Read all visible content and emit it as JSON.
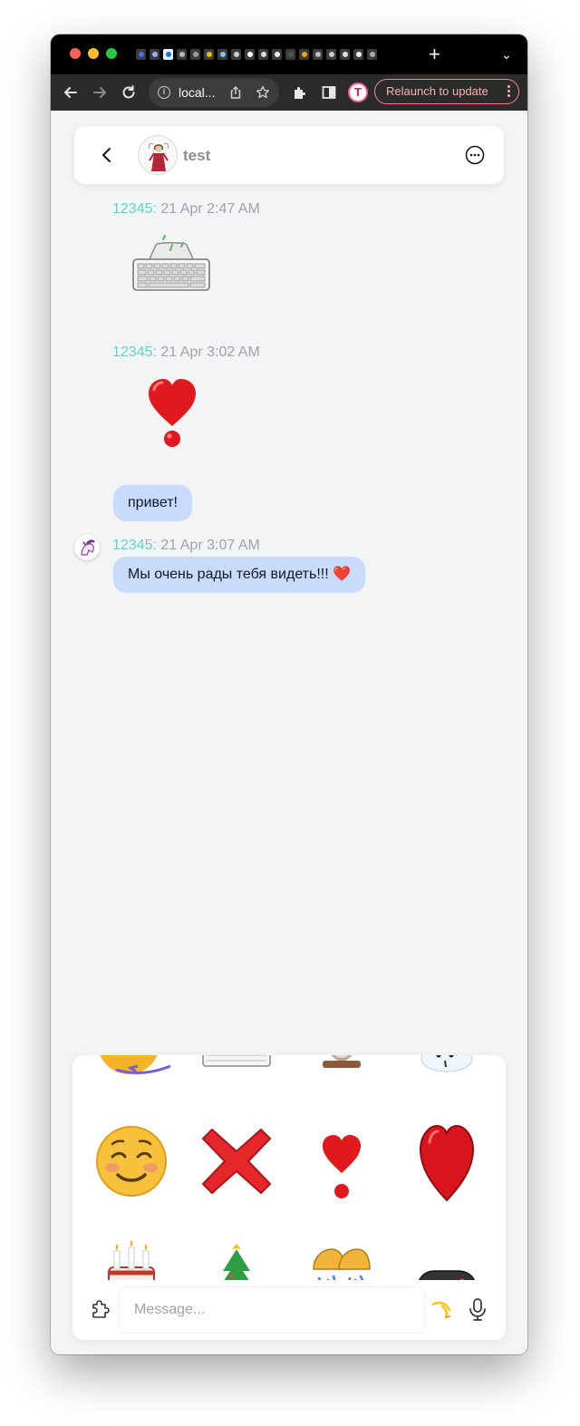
{
  "browser": {
    "url_display": "local...",
    "relaunch_label": "Relaunch to update",
    "profile_initial": "T",
    "new_tab_symbol": "+"
  },
  "chat": {
    "title": "test",
    "messages": [
      {
        "author": "12345:",
        "timestamp": "21 Apr 2:47 AM",
        "sticker": "keyboard-sticker"
      },
      {
        "author": "12345:",
        "timestamp": "21 Apr 3:02 AM",
        "sticker": "heart-exclamation-sticker"
      },
      {
        "text": "привет!"
      },
      {
        "author": "12345:",
        "timestamp": "21 Apr 3:07 AM",
        "text": "Мы очень рады тебя видеть!!! ❤️"
      }
    ]
  },
  "sticker_panel": {
    "rows": [
      [
        "kiss-face-sticker",
        "keyboard-sticker",
        "hourglass-sticker",
        "snowman-sticker"
      ],
      [
        "smiling-blush-face-sticker",
        "cross-mark-sticker",
        "heart-exclamation-sticker",
        "red-heart-sticker"
      ],
      [
        "birthday-cake-sticker",
        "christmas-tree-sticker",
        "party-bells-sticker",
        "gamepad-sticker"
      ]
    ]
  },
  "composer": {
    "placeholder": "Message..."
  },
  "colors": {
    "author": "#5fd3c6",
    "timestamp": "#9ca3af",
    "bubble": "#c8dbfb",
    "background": "#f3f4f6",
    "relaunch": "#f28b82"
  }
}
